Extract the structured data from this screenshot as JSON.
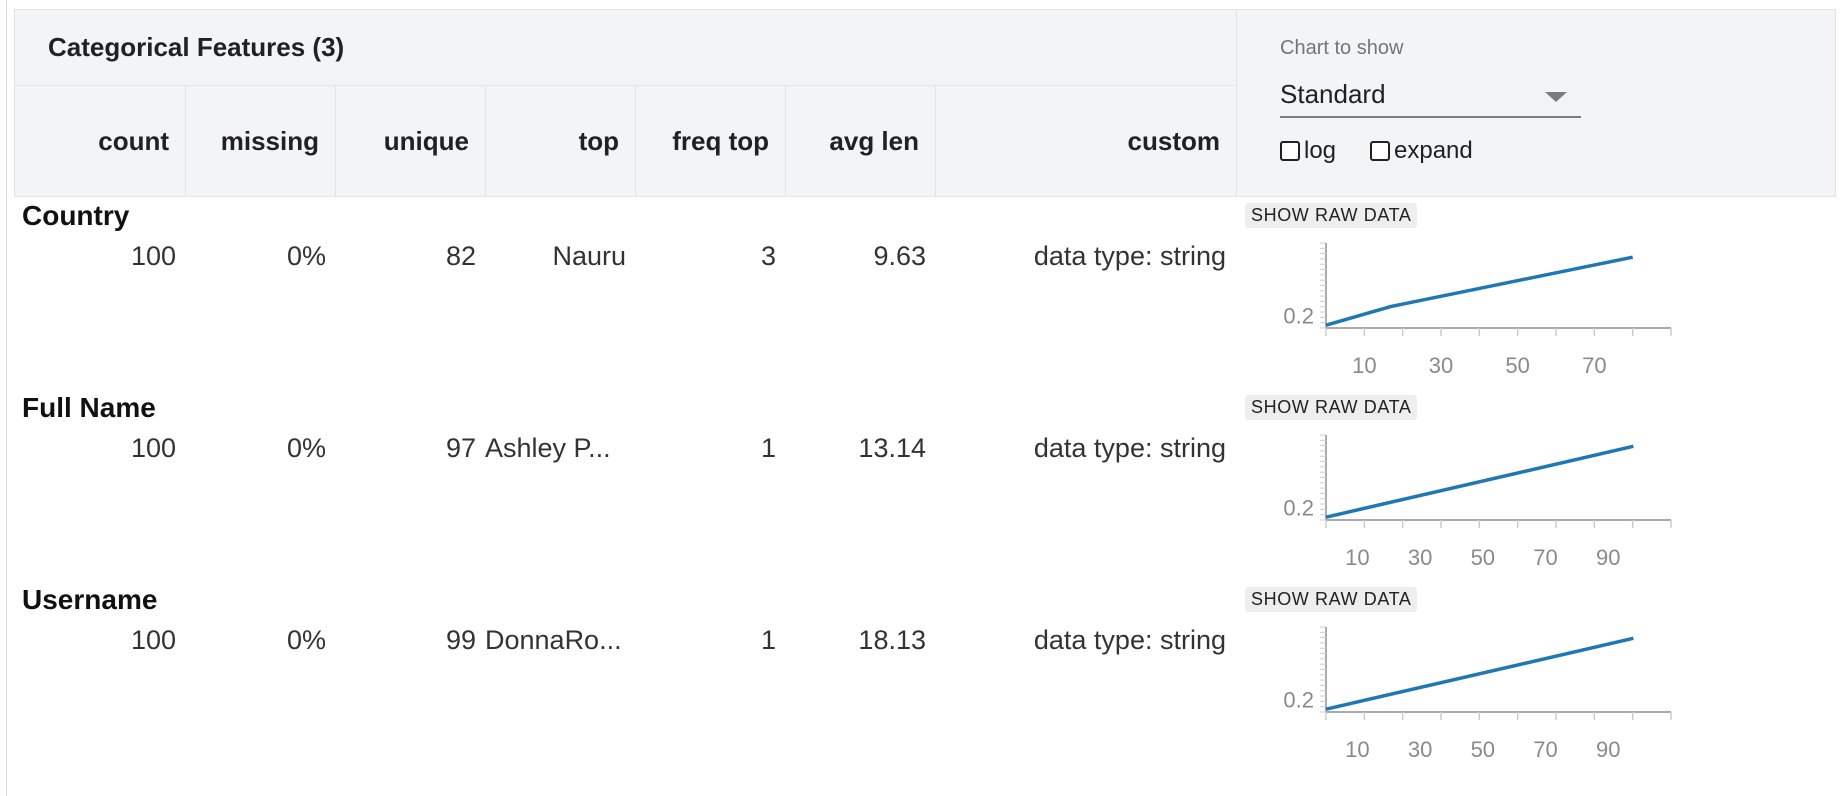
{
  "header": {
    "title": "Categorical Features (3)",
    "columns": [
      "count",
      "missing",
      "unique",
      "top",
      "freq top",
      "avg len",
      "custom"
    ]
  },
  "controls": {
    "chart_label": "Chart to show",
    "chart_value": "Standard",
    "log_label": "log",
    "expand_label": "expand",
    "log_checked": false,
    "expand_checked": false
  },
  "colors": {
    "line": "#1f77b4",
    "header_bg": "#f3f4f6"
  },
  "show_raw_label": "SHOW RAW DATA",
  "rows": [
    {
      "name": "Country",
      "count": "100",
      "missing": "0%",
      "unique": "82",
      "top": "Nauru",
      "freq_top": "3",
      "avg_len": "9.63",
      "custom": "data type: string"
    },
    {
      "name": "Full Name",
      "count": "100",
      "missing": "0%",
      "unique": "97",
      "top": "Ashley P...",
      "freq_top": "1",
      "avg_len": "13.14",
      "custom": "data type: string"
    },
    {
      "name": "Username",
      "count": "100",
      "missing": "0%",
      "unique": "99",
      "top": "DonnaRo...",
      "freq_top": "1",
      "avg_len": "18.13",
      "custom": "data type: string"
    }
  ],
  "chart_data": [
    {
      "type": "line",
      "title": "",
      "xlabel": "",
      "ylabel": "",
      "x_ticks": [
        10,
        30,
        50,
        70
      ],
      "y_ticks": [
        0.2
      ],
      "xlim": [
        0,
        90
      ],
      "ylim": [
        0.18,
        0.33
      ],
      "series": [
        {
          "x": [
            0,
            17,
            80
          ],
          "y": [
            0.185,
            0.218,
            0.305
          ]
        }
      ]
    },
    {
      "type": "line",
      "title": "",
      "xlabel": "",
      "ylabel": "",
      "x_ticks": [
        10,
        30,
        50,
        70,
        90
      ],
      "y_ticks": [
        0.2
      ],
      "xlim": [
        0,
        110
      ],
      "ylim": [
        0.18,
        0.33
      ],
      "series": [
        {
          "x": [
            0,
            98
          ],
          "y": [
            0.185,
            0.31
          ]
        }
      ]
    },
    {
      "type": "line",
      "title": "",
      "xlabel": "",
      "ylabel": "",
      "x_ticks": [
        10,
        30,
        50,
        70,
        90
      ],
      "y_ticks": [
        0.2
      ],
      "xlim": [
        0,
        110
      ],
      "ylim": [
        0.18,
        0.33
      ],
      "series": [
        {
          "x": [
            0,
            98
          ],
          "y": [
            0.185,
            0.31
          ]
        }
      ]
    }
  ]
}
